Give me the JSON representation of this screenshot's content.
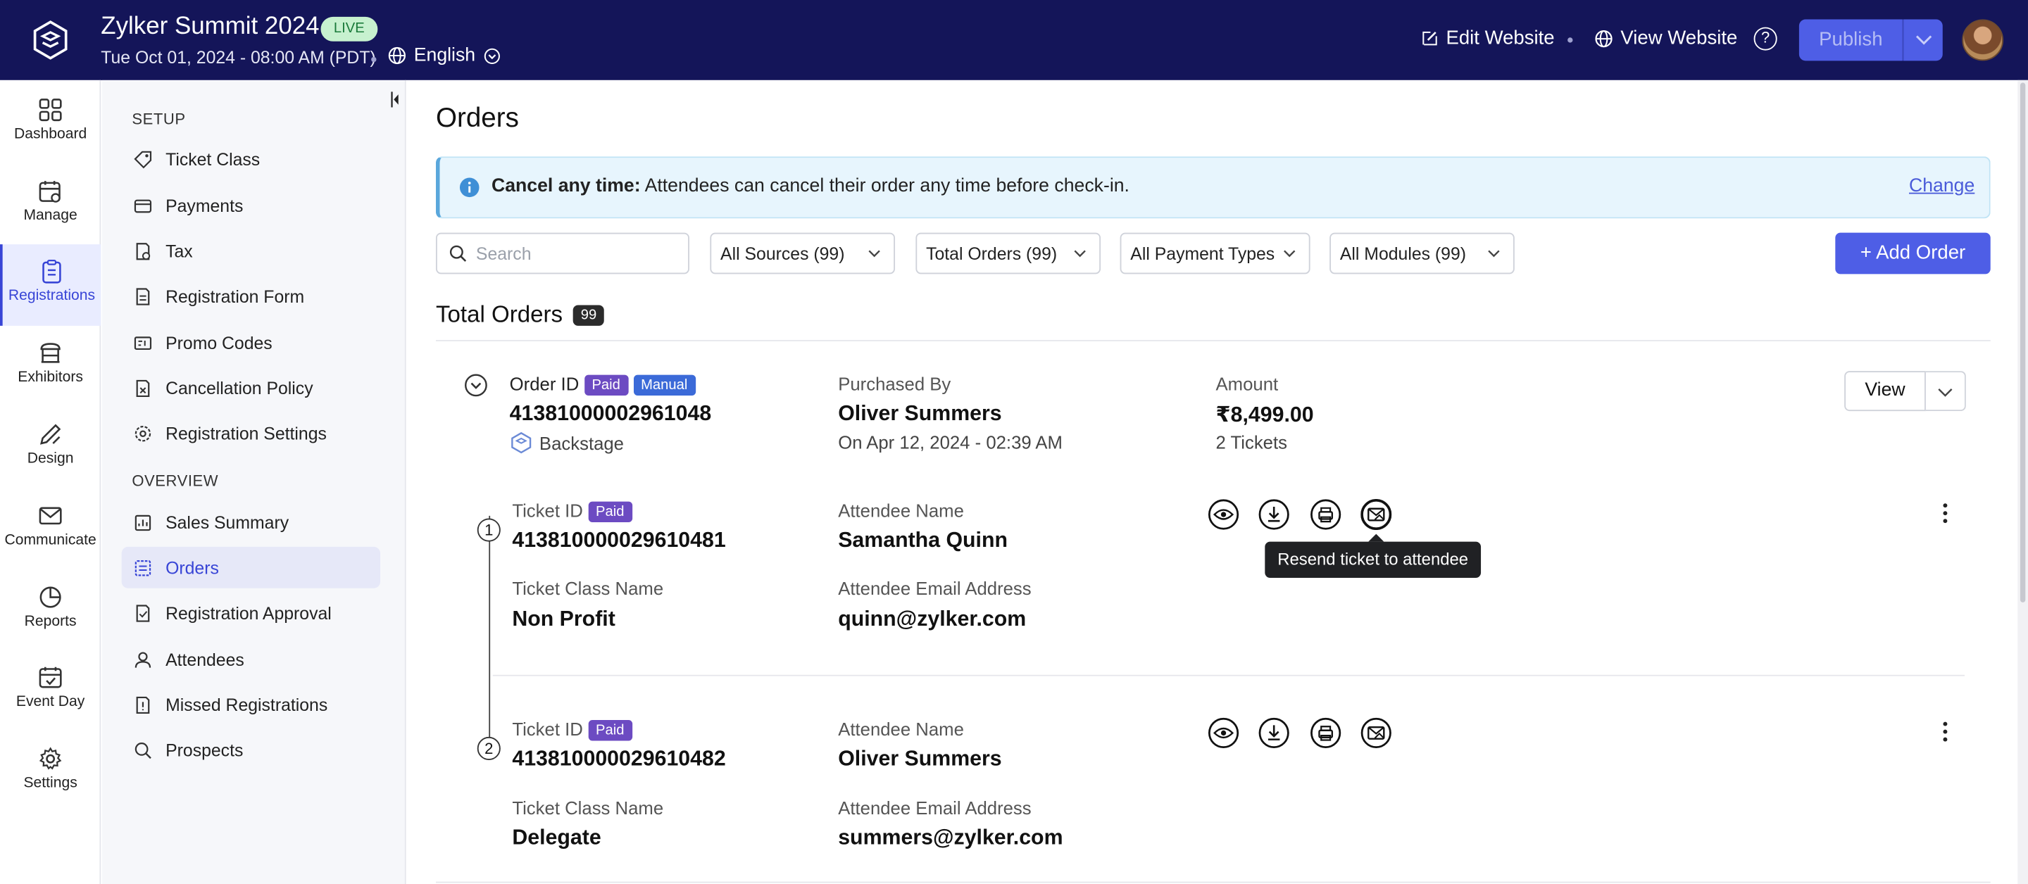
{
  "header": {
    "event_title": "Zylker Summit 2024",
    "live_badge": "LIVE",
    "datetime": "Tue Oct 01, 2024 - 08:00 AM (PDT)",
    "language": "English",
    "edit_website": "Edit Website",
    "view_website": "View Website",
    "publish": "Publish"
  },
  "rail": {
    "items": [
      {
        "label": "Dashboard",
        "icon": "grid-icon"
      },
      {
        "label": "Manage",
        "icon": "calendar-gear-icon"
      },
      {
        "label": "Registrations",
        "icon": "clipboard-icon",
        "active": true
      },
      {
        "label": "Exhibitors",
        "icon": "booth-icon"
      },
      {
        "label": "Design",
        "icon": "pen-ruler-icon"
      },
      {
        "label": "Communicate",
        "icon": "mail-icon"
      },
      {
        "label": "Reports",
        "icon": "pie-chart-icon"
      },
      {
        "label": "Event Day",
        "icon": "calendar-check-icon"
      },
      {
        "label": "Settings",
        "icon": "gear-icon"
      }
    ]
  },
  "subnav": {
    "setup_heading": "SETUP",
    "setup": [
      "Ticket Class",
      "Payments",
      "Tax",
      "Registration Form",
      "Promo Codes",
      "Cancellation Policy",
      "Registration Settings"
    ],
    "overview_heading": "OVERVIEW",
    "overview": [
      "Sales Summary",
      "Orders",
      "Registration Approval",
      "Attendees",
      "Missed Registrations",
      "Prospects"
    ],
    "active": "Orders"
  },
  "main": {
    "title": "Orders",
    "banner_bold": "Cancel any time:",
    "banner_text": " Attendees can cancel their order any time before check-in.",
    "banner_link": "Change",
    "search_placeholder": "Search",
    "filters": [
      "All Sources (99)",
      "Total Orders (99)",
      "All Payment Types",
      "All Modules (99)"
    ],
    "add_order": "Add Order",
    "total_label": "Total Orders",
    "total_count": "99"
  },
  "order": {
    "id_label": "Order ID",
    "badges": [
      "Paid",
      "Manual"
    ],
    "id": "413810000029610 48",
    "id_value": "41381000002961048",
    "source": "Backstage",
    "purchased_by_label": "Purchased By",
    "purchased_by": "Oliver Summers",
    "purchased_on": "On Apr 12, 2024 - 02:39 AM",
    "amount_label": "Amount",
    "amount": "₹8,499.00",
    "tickets": "2 Tickets",
    "view": "View"
  },
  "tickets": [
    {
      "index": "1",
      "id_label": "Ticket ID",
      "badge": "Paid",
      "id": "413810000029610481",
      "class_label": "Ticket Class Name",
      "class": "Non Profit",
      "attendee_label": "Attendee Name",
      "attendee": "Samantha Quinn",
      "email_label": "Attendee Email Address",
      "email": "quinn@zylker.com"
    },
    {
      "index": "2",
      "id_label": "Ticket ID",
      "badge": "Paid",
      "id": "413810000029610482",
      "class_label": "Ticket Class Name",
      "class": "Delegate",
      "attendee_label": "Attendee Name",
      "attendee": "Oliver Summers",
      "email_label": "Attendee Email Address",
      "email": "summers@zylker.com"
    }
  ],
  "tooltip": "Resend ticket to attendee",
  "colors": {
    "header_bg": "#141559",
    "primary": "#4e5ee6",
    "paid_badge": "#6c4bc2",
    "manual_badge": "#3b6ad8",
    "live_badge_bg": "#c7f1cf"
  }
}
